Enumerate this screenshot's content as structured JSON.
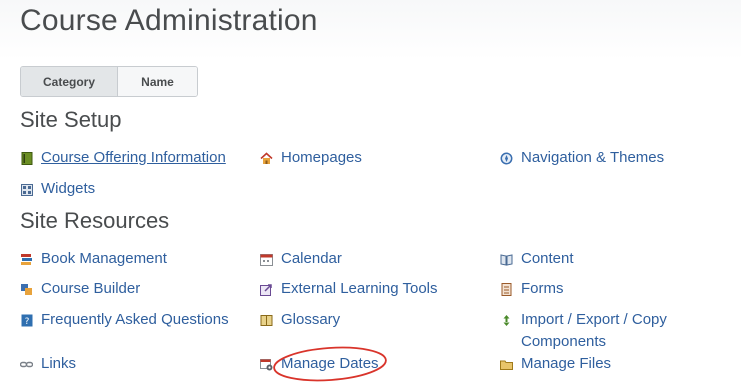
{
  "page": {
    "title": "Course Administration"
  },
  "view_toggle": {
    "category_label": "Category",
    "name_label": "Name",
    "selected": "Category"
  },
  "site_setup": {
    "heading": "Site Setup",
    "items": [
      {
        "label": "Course Offering Information",
        "icon": "book-info-icon"
      },
      {
        "label": "Homepages",
        "icon": "home-icon"
      },
      {
        "label": "Navigation & Themes",
        "icon": "compass-icon"
      },
      {
        "label": "Widgets",
        "icon": "widgets-grid-icon"
      }
    ]
  },
  "site_resources": {
    "heading": "Site Resources",
    "items": [
      {
        "label": "Book Management",
        "icon": "books-icon"
      },
      {
        "label": "Calendar",
        "icon": "calendar-icon"
      },
      {
        "label": "Content",
        "icon": "open-book-icon"
      },
      {
        "label": "Course Builder",
        "icon": "blocks-icon"
      },
      {
        "label": "External Learning Tools",
        "icon": "external-tool-icon"
      },
      {
        "label": "Forms",
        "icon": "forms-icon"
      },
      {
        "label": "Frequently Asked Questions",
        "icon": "faq-icon"
      },
      {
        "label": "Glossary",
        "icon": "glossary-book-icon"
      },
      {
        "label": "Import / Export / Copy Components",
        "icon": "import-export-icon"
      },
      {
        "label": "Links",
        "icon": "chain-link-icon"
      },
      {
        "label": "Manage Dates",
        "icon": "calendar-gear-icon"
      },
      {
        "label": "Manage Files",
        "icon": "folder-icon"
      }
    ]
  },
  "colors": {
    "link": "#2f5f9e",
    "heading": "#494c4e",
    "annotation": "#d9342b"
  }
}
